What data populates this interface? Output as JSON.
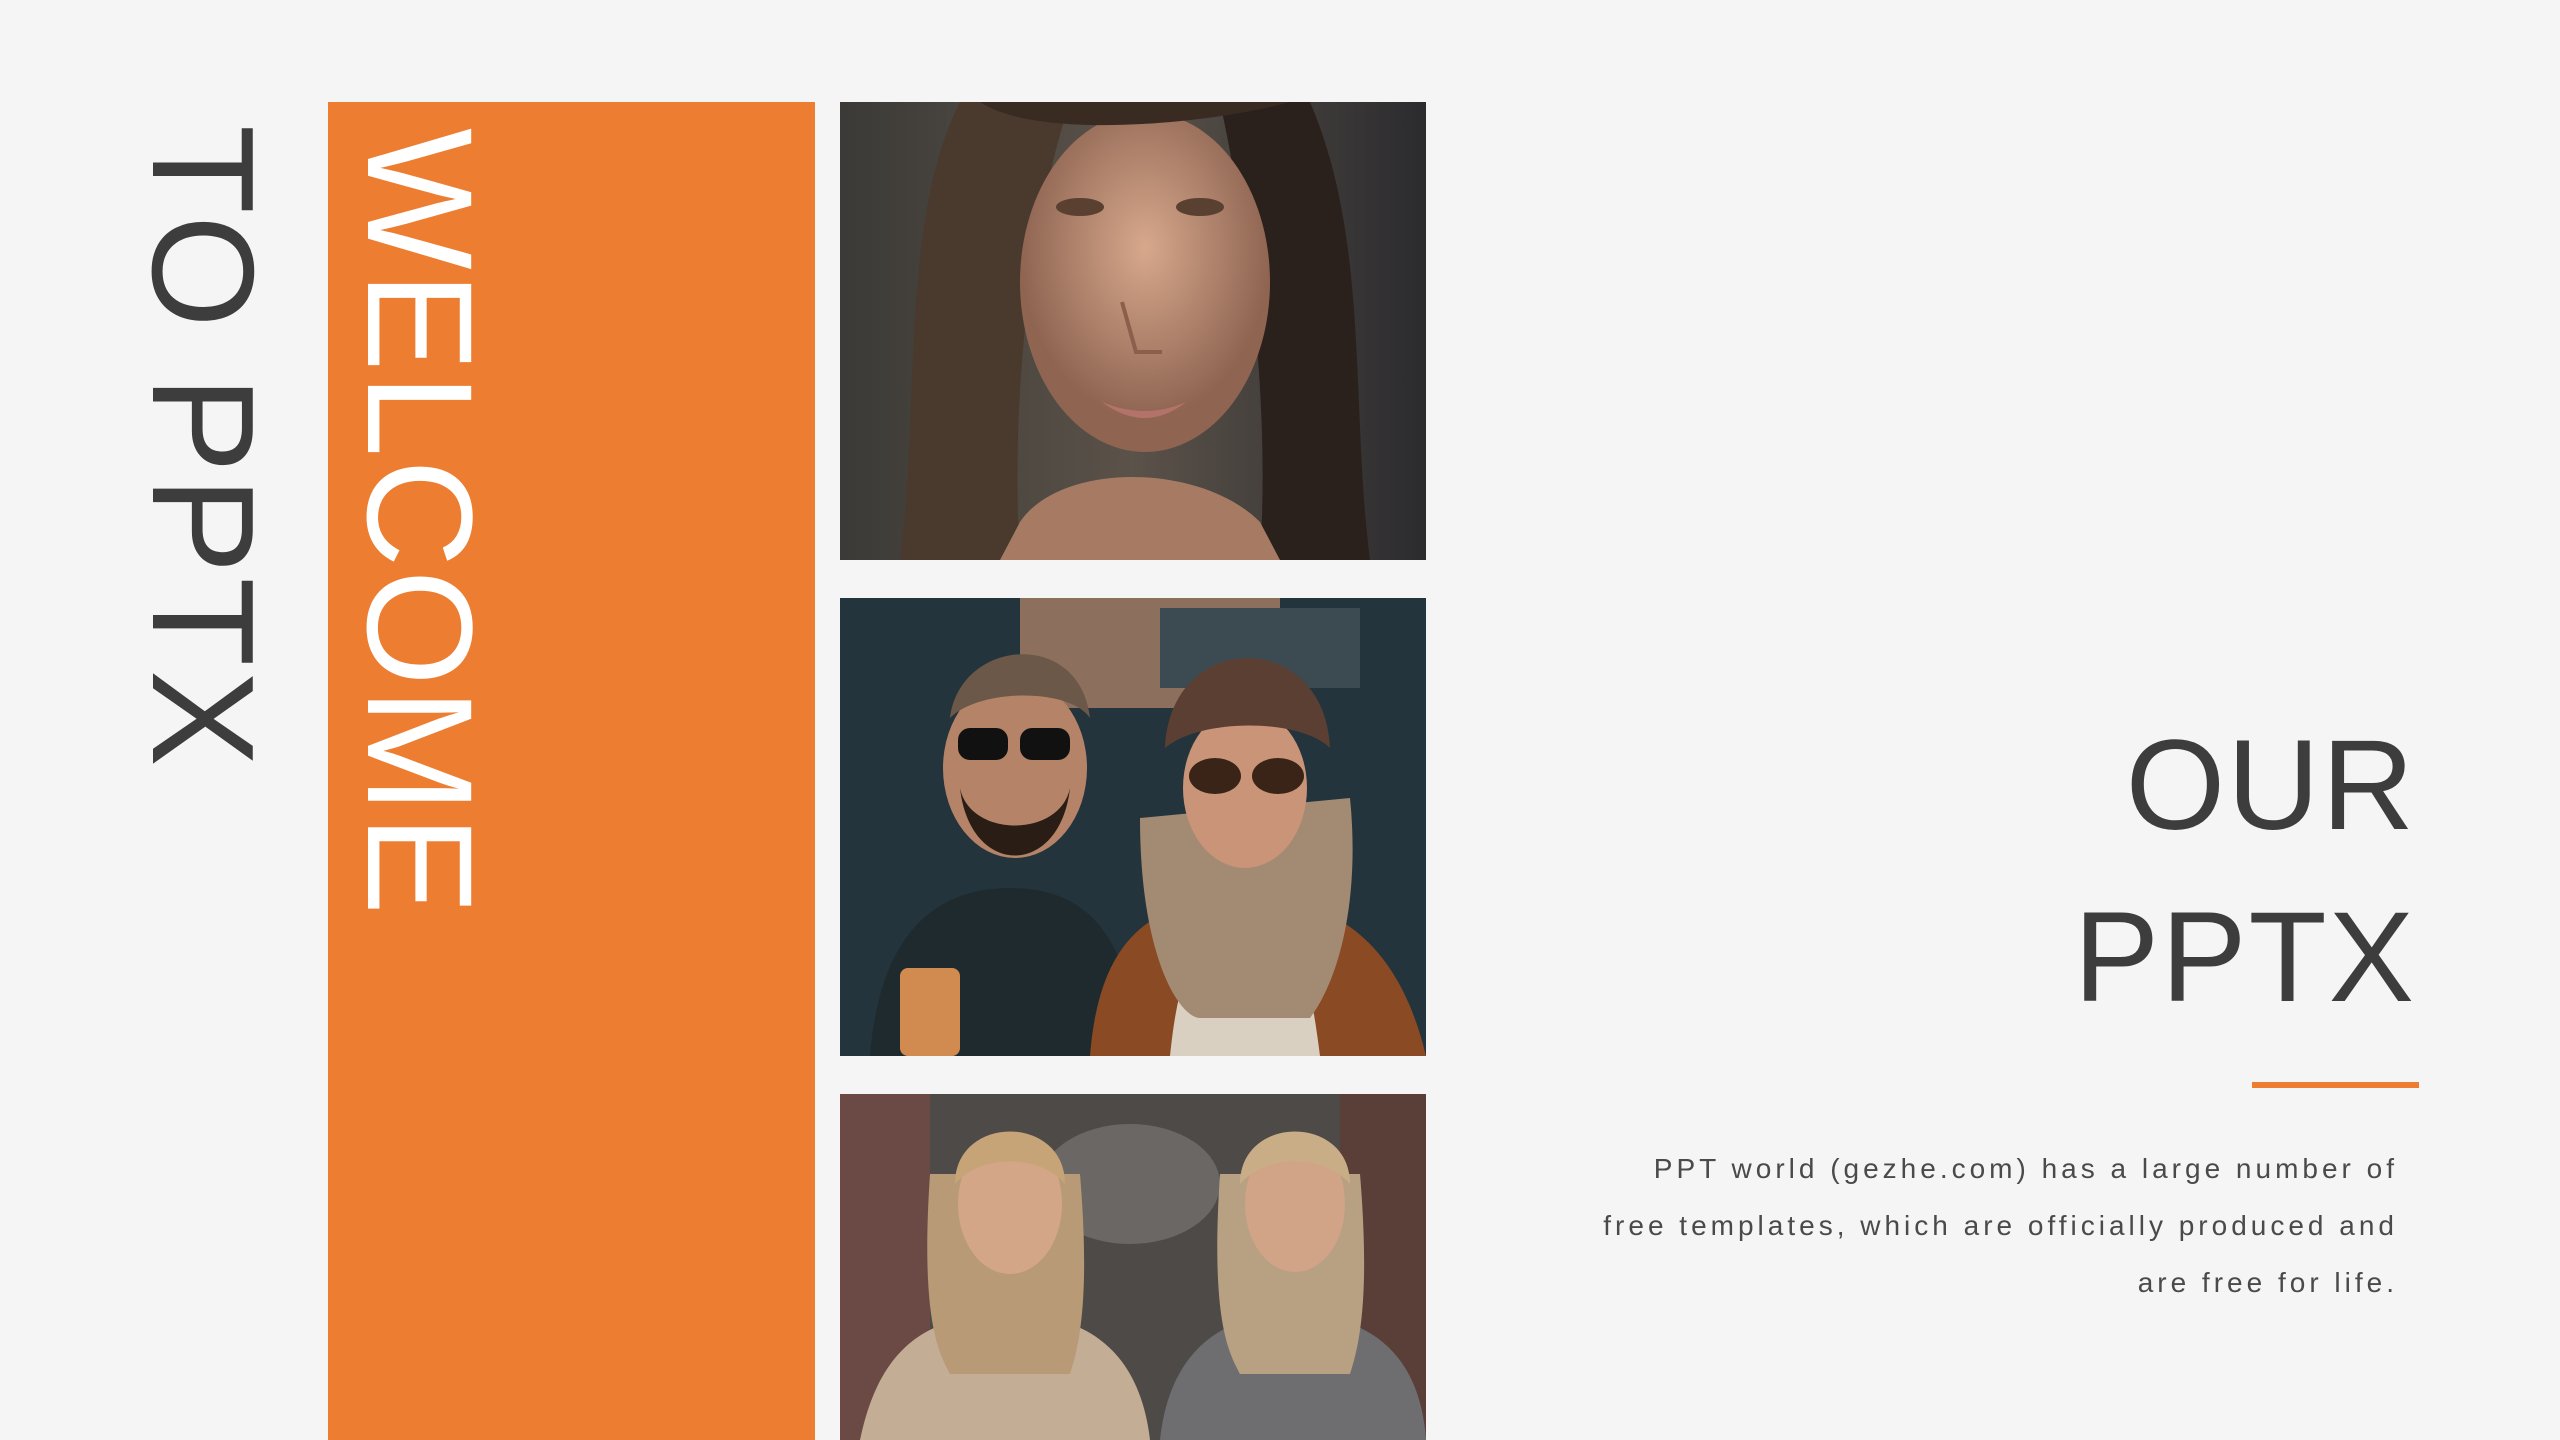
{
  "side_title": "TO PPTX",
  "banner_title": "WELCOME",
  "headline": {
    "line1": "OUR",
    "line2": "PPTX"
  },
  "description": "PPT world (gezhe.com) has a large number of free templates, which are officially produced and are free for life.",
  "photos": [
    {
      "name": "portrait-woman-photo"
    },
    {
      "name": "couple-street-photo"
    },
    {
      "name": "two-women-street-photo"
    }
  ],
  "colors": {
    "accent": "#ed7d31",
    "text": "#3d3d3d",
    "background": "#f5f5f5"
  }
}
